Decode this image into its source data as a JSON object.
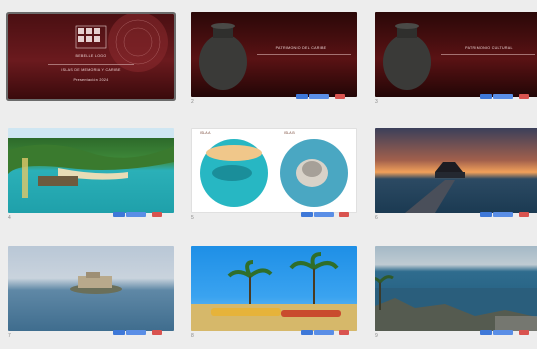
{
  "slides": [
    {
      "number": "1",
      "title_lines": [
        "BEBELLE LOGO",
        "ISLAS DE MEMORIA Y CARIBE",
        "Presentación 2024"
      ],
      "selected": true,
      "kind": "title"
    },
    {
      "number": "2",
      "title_lines": [
        "PATRIMONIO DEL CARIBE"
      ],
      "selected": false,
      "kind": "vase"
    },
    {
      "number": "3",
      "title_lines": [
        "PATRIMONIO CULTURAL"
      ],
      "selected": false,
      "kind": "vase"
    },
    {
      "number": "4",
      "title_lines": [],
      "selected": false,
      "kind": "beach"
    },
    {
      "number": "5",
      "title_lines": [
        "ISLA A",
        "ISLA B"
      ],
      "selected": false,
      "kind": "circles"
    },
    {
      "number": "6",
      "title_lines": [],
      "selected": false,
      "kind": "sunset"
    },
    {
      "number": "7",
      "title_lines": [],
      "selected": false,
      "kind": "island"
    },
    {
      "number": "8",
      "title_lines": [],
      "selected": false,
      "kind": "palms"
    },
    {
      "number": "9",
      "title_lines": [],
      "selected": false,
      "kind": "coast"
    }
  ],
  "colors": {
    "background": "#ededed",
    "action_blue": "#3e78d8",
    "action_red": "#d9534f",
    "title_bg": "#5a1414"
  }
}
